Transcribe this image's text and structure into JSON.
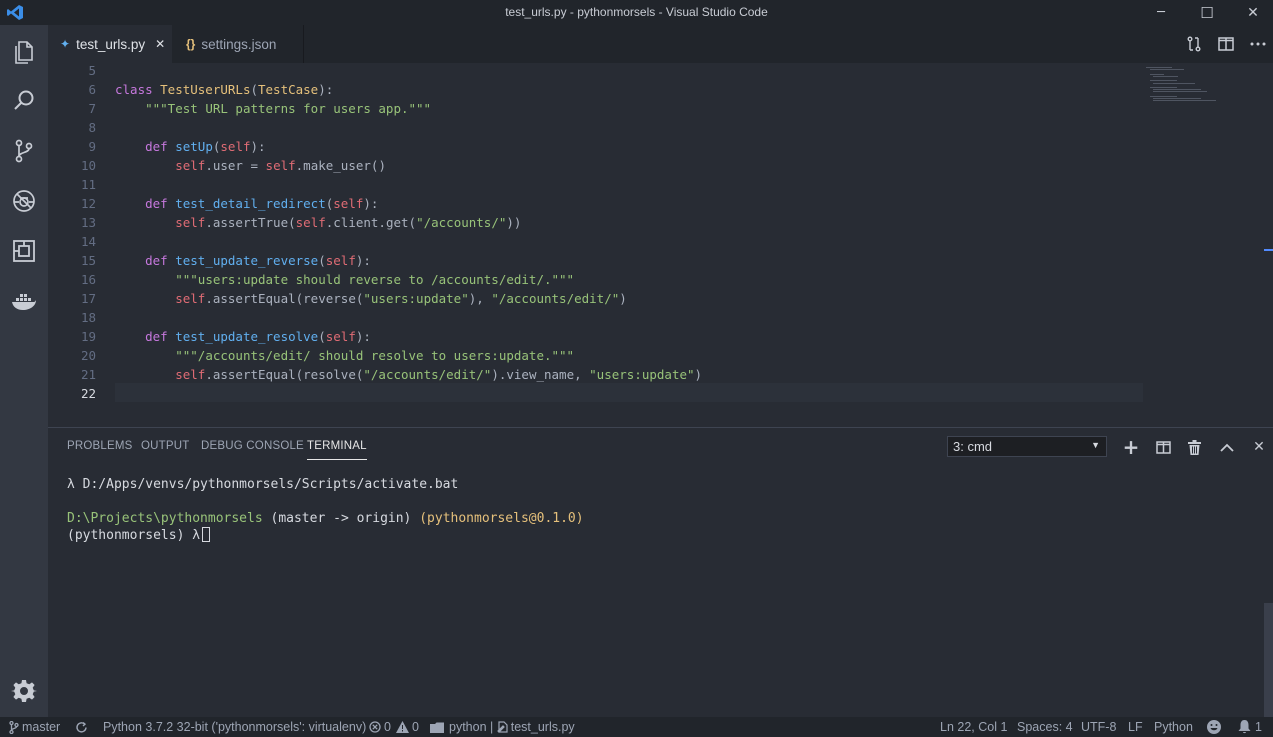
{
  "window": {
    "title": "test_urls.py - pythonmorsels - Visual Studio Code",
    "minimize_glyph": "─",
    "maximize_glyph": "☐",
    "close_glyph": "✕"
  },
  "activity_bar": {
    "items": [
      "files-icon",
      "search-icon",
      "source-control-icon",
      "debug-icon",
      "extensions-icon",
      "docker-icon"
    ],
    "settings": "gear-icon"
  },
  "tabs": [
    {
      "label": "test_urls.py",
      "icon": "python-file-icon",
      "icon_glyph": "✦",
      "close": "✕",
      "active": true
    },
    {
      "label": "settings.json",
      "icon": "json-file-icon",
      "icon_glyph": "{}",
      "active": false
    }
  ],
  "editor": {
    "current_line": 22,
    "line_numbers": [
      "5",
      "6",
      "7",
      "8",
      "9",
      "10",
      "11",
      "12",
      "13",
      "14",
      "15",
      "16",
      "17",
      "18",
      "19",
      "20",
      "21",
      "22"
    ],
    "lines": [
      [],
      [
        {
          "t": "class ",
          "c": "kw"
        },
        {
          "t": "TestUserURLs",
          "c": "cls"
        },
        {
          "t": "(",
          "c": "pl"
        },
        {
          "t": "TestCase",
          "c": "cls"
        },
        {
          "t": "):",
          "c": "pl"
        }
      ],
      [
        {
          "t": "    ",
          "c": "pl"
        },
        {
          "t": "\"\"\"Test URL patterns for users app.\"\"\"",
          "c": "str"
        }
      ],
      [],
      [
        {
          "t": "    ",
          "c": "pl"
        },
        {
          "t": "def ",
          "c": "kw"
        },
        {
          "t": "setUp",
          "c": "fn"
        },
        {
          "t": "(",
          "c": "pl"
        },
        {
          "t": "self",
          "c": "slf"
        },
        {
          "t": "):",
          "c": "pl"
        }
      ],
      [
        {
          "t": "        ",
          "c": "pl"
        },
        {
          "t": "self",
          "c": "slf"
        },
        {
          "t": ".user = ",
          "c": "pl"
        },
        {
          "t": "self",
          "c": "slf"
        },
        {
          "t": ".make_user()",
          "c": "pl"
        }
      ],
      [],
      [
        {
          "t": "    ",
          "c": "pl"
        },
        {
          "t": "def ",
          "c": "kw"
        },
        {
          "t": "test_detail_redirect",
          "c": "fn"
        },
        {
          "t": "(",
          "c": "pl"
        },
        {
          "t": "self",
          "c": "slf"
        },
        {
          "t": "):",
          "c": "pl"
        }
      ],
      [
        {
          "t": "        ",
          "c": "pl"
        },
        {
          "t": "self",
          "c": "slf"
        },
        {
          "t": ".assertTrue(",
          "c": "pl"
        },
        {
          "t": "self",
          "c": "slf"
        },
        {
          "t": ".client.get(",
          "c": "pl"
        },
        {
          "t": "\"/accounts/\"",
          "c": "str"
        },
        {
          "t": "))",
          "c": "pl"
        }
      ],
      [],
      [
        {
          "t": "    ",
          "c": "pl"
        },
        {
          "t": "def ",
          "c": "kw"
        },
        {
          "t": "test_update_reverse",
          "c": "fn"
        },
        {
          "t": "(",
          "c": "pl"
        },
        {
          "t": "self",
          "c": "slf"
        },
        {
          "t": "):",
          "c": "pl"
        }
      ],
      [
        {
          "t": "        ",
          "c": "pl"
        },
        {
          "t": "\"\"\"users:update should reverse to /accounts/edit/.\"\"\"",
          "c": "str"
        }
      ],
      [
        {
          "t": "        ",
          "c": "pl"
        },
        {
          "t": "self",
          "c": "slf"
        },
        {
          "t": ".assertEqual(reverse(",
          "c": "pl"
        },
        {
          "t": "\"users:update\"",
          "c": "str"
        },
        {
          "t": "), ",
          "c": "pl"
        },
        {
          "t": "\"/accounts/edit/\"",
          "c": "str"
        },
        {
          "t": ")",
          "c": "pl"
        }
      ],
      [],
      [
        {
          "t": "    ",
          "c": "pl"
        },
        {
          "t": "def ",
          "c": "kw"
        },
        {
          "t": "test_update_resolve",
          "c": "fn"
        },
        {
          "t": "(",
          "c": "pl"
        },
        {
          "t": "self",
          "c": "slf"
        },
        {
          "t": "):",
          "c": "pl"
        }
      ],
      [
        {
          "t": "        ",
          "c": "pl"
        },
        {
          "t": "\"\"\"/accounts/edit/ should resolve to users:update.\"\"\"",
          "c": "str"
        }
      ],
      [
        {
          "t": "        ",
          "c": "pl"
        },
        {
          "t": "self",
          "c": "slf"
        },
        {
          "t": ".assertEqual(resolve(",
          "c": "pl"
        },
        {
          "t": "\"/accounts/edit/\"",
          "c": "str"
        },
        {
          "t": ").view_name, ",
          "c": "pl"
        },
        {
          "t": "\"users:update\"",
          "c": "str"
        },
        {
          "t": ")",
          "c": "pl"
        }
      ],
      []
    ]
  },
  "panel": {
    "tabs": [
      "PROBLEMS",
      "OUTPUT",
      "DEBUG CONSOLE",
      "TERMINAL"
    ],
    "active_tab": "TERMINAL",
    "terminal_select": "3: cmd",
    "select_arrow": "▼",
    "actions": {
      "add": "+",
      "split": "split-icon",
      "trash": "trash-icon",
      "maximize": "chevron-up-icon",
      "close": "✕"
    },
    "terminal": {
      "line1": "λ D:/Apps/venvs/pythonmorsels/Scripts/activate.bat",
      "line2_path": "D:\\Projects\\pythonmorsels",
      "line2_branch": "(master -> origin)",
      "line2_pkg": "(pythonmorsels@0.1.0)",
      "line3": "(pythonmorsels) λ"
    }
  },
  "statusbar": {
    "branch": "master",
    "python": "Python 3.7.2 32-bit ('pythonmorsels': virtualenv)",
    "errors": "0",
    "warnings": "0",
    "terminal": "python | ",
    "file": "test_urls.py",
    "position": "Ln 22, Col 1",
    "spaces": "Spaces: 4",
    "encoding": "UTF-8",
    "eol": "LF",
    "language": "Python",
    "notifications": "1"
  },
  "colors": {
    "accent": "#528bff",
    "keyword": "#c678dd",
    "class": "#e5c07b",
    "function": "#61afef",
    "self": "#e06c75",
    "string": "#98c379"
  }
}
